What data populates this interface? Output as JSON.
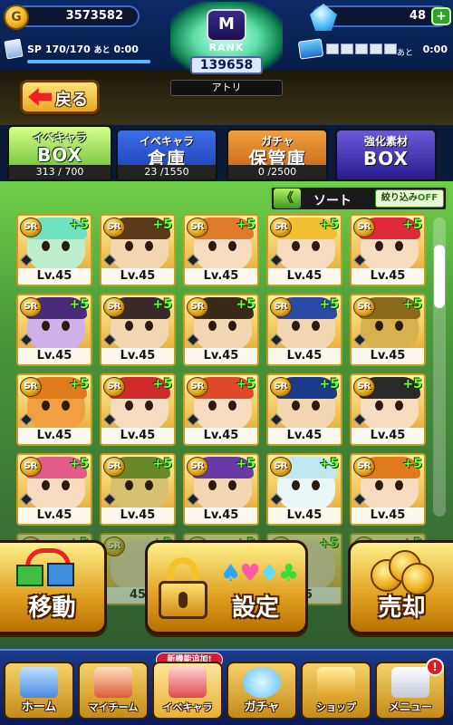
{
  "header": {
    "coins": "3573582",
    "gems": "48",
    "gems_plus": "+",
    "sp_label": "SP",
    "sp_value": "170/170",
    "sp_after_label": "あと",
    "sp_time": "0:00",
    "sp_fill_fraction": 1.0,
    "stamina_after_label": "あと",
    "stamina_time": "0:00",
    "stamina_boxes": 5
  },
  "rank": {
    "badge": "M",
    "label": "RANK",
    "value": "139658",
    "player_name": "アトリ"
  },
  "nav_back": {
    "label": "戻る"
  },
  "tabs": [
    {
      "top": "イベキャラ",
      "main": "BOX",
      "count": "313 / 700",
      "active": true
    },
    {
      "top": "イベキャラ",
      "main": "倉庫",
      "count": "23 /1550",
      "active": false
    },
    {
      "top": "ガチャ",
      "main": "保管庫",
      "count": "0 /2500",
      "active": false
    },
    {
      "top": "強化素材",
      "main": "BOX",
      "count": "",
      "active": false
    }
  ],
  "sort": {
    "arrows": "《",
    "label": "ソート",
    "filter_label": "絞り込み",
    "filter_state": "OFF"
  },
  "cards": [
    {
      "rarity": "SR",
      "plus": "+5",
      "level": "Lv.45",
      "hair": "#6fe0c0",
      "skin": "#bfeecf"
    },
    {
      "rarity": "SR",
      "plus": "+5",
      "level": "Lv.45",
      "hair": "#5a3a1a",
      "skin": "#f3d7b0"
    },
    {
      "rarity": "SR",
      "plus": "+5",
      "level": "Lv.45",
      "hair": "#e07a2a",
      "skin": "#f7dcc0"
    },
    {
      "rarity": "SR",
      "plus": "+5",
      "level": "Lv.45",
      "hair": "#f0c030",
      "skin": "#f7dcc0"
    },
    {
      "rarity": "SR",
      "plus": "+5",
      "level": "Lv.45",
      "hair": "#e02a3a",
      "skin": "#f7dcc0"
    },
    {
      "rarity": "SR",
      "plus": "+5",
      "level": "Lv.45",
      "hair": "#4a2a7a",
      "skin": "#d0b0e8"
    },
    {
      "rarity": "SR",
      "plus": "+5",
      "level": "Lv.45",
      "hair": "#3a2a2a",
      "skin": "#f3d7b0"
    },
    {
      "rarity": "SR",
      "plus": "+5",
      "level": "Lv.45",
      "hair": "#3a2a1a",
      "skin": "#f3d7b0"
    },
    {
      "rarity": "SR",
      "plus": "+5",
      "level": "Lv.45",
      "hair": "#2a4aa8",
      "skin": "#f3d7b0"
    },
    {
      "rarity": "SR",
      "plus": "+5",
      "level": "Lv.45",
      "hair": "#8a6a1a",
      "skin": "#d8b050"
    },
    {
      "rarity": "SR",
      "plus": "+5",
      "level": "Lv.45",
      "hair": "#e07a1a",
      "skin": "#f0a040"
    },
    {
      "rarity": "SR",
      "plus": "+5",
      "level": "Lv.45",
      "hair": "#d02a2a",
      "skin": "#f7dcc0"
    },
    {
      "rarity": "SR",
      "plus": "+5",
      "level": "Lv.45",
      "hair": "#e04a2a",
      "skin": "#f7dcc0"
    },
    {
      "rarity": "SR",
      "plus": "+5",
      "level": "Lv.45",
      "hair": "#1a3a8a",
      "skin": "#f3d7b0"
    },
    {
      "rarity": "SR",
      "plus": "+5",
      "level": "Lv.45",
      "hair": "#2a2a2a",
      "skin": "#f7dcc0"
    },
    {
      "rarity": "SR",
      "plus": "+5",
      "level": "Lv.45",
      "hair": "#e05a8a",
      "skin": "#f7dcc0"
    },
    {
      "rarity": "SR",
      "plus": "+5",
      "level": "Lv.45",
      "hair": "#6a8a2a",
      "skin": "#d8c070"
    },
    {
      "rarity": "SR",
      "plus": "+5",
      "level": "Lv.45",
      "hair": "#6a3aa8",
      "skin": "#f3d7b0"
    },
    {
      "rarity": "SR",
      "plus": "+5",
      "level": "Lv.45",
      "hair": "#bfe8f0",
      "skin": "#e8f6f8"
    },
    {
      "rarity": "SR",
      "plus": "+5",
      "level": "Lv.45",
      "hair": "#e07a1a",
      "skin": "#f7dcc0"
    }
  ],
  "partial_row_plus": "+5",
  "partial_row_level": "45",
  "actions": {
    "move": "移動",
    "setting": "設定",
    "sell": "売却",
    "suits": [
      "♠",
      "♥",
      "♦",
      "♣"
    ]
  },
  "bottom_nav": {
    "new_badge": "新機能追加!",
    "items": [
      "ホーム",
      "マイチーム",
      "イベキャラ",
      "ガチャ",
      "ショップ",
      "メニュー"
    ],
    "notice": "!"
  }
}
